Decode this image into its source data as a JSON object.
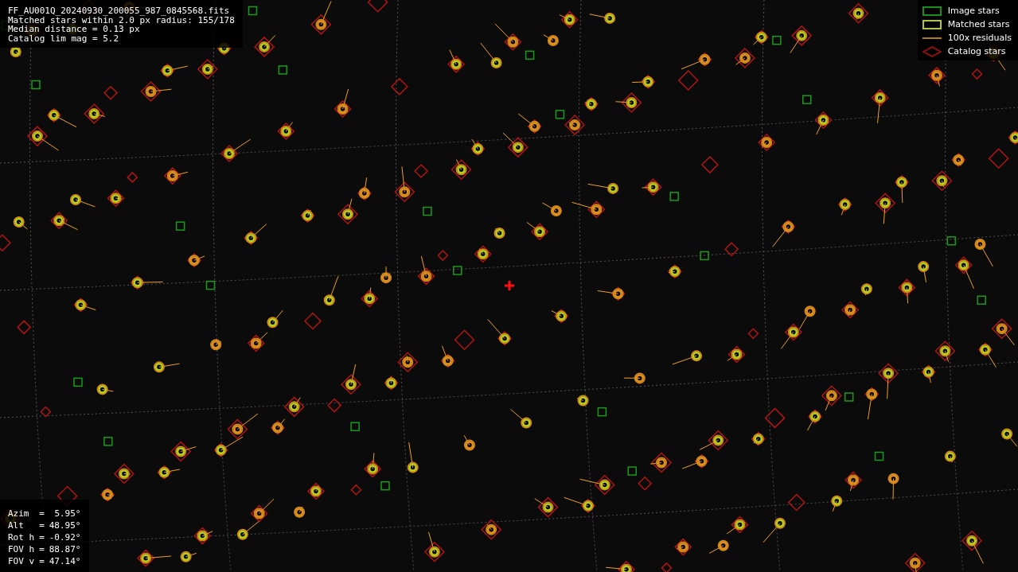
{
  "info": {
    "lines": [
      "FF_AU001Q_20240930_200055_987_0845568.fits",
      "Matched stars within 2.0 px radius: 155/178",
      "Median distance = 0.13 px",
      "Catalog lim mag = 5.2"
    ]
  },
  "legend": [
    {
      "kind": "image",
      "label": "Image stars"
    },
    {
      "kind": "matched",
      "label": "Matched stars"
    },
    {
      "kind": "residual",
      "label": "100x residuals"
    },
    {
      "kind": "catalog",
      "label": "Catalog stars"
    }
  ],
  "pointing": [
    {
      "label": "Azim",
      "sign": "=",
      "value": "5.95°"
    },
    {
      "label": "Alt",
      "sign": "=",
      "value": "48.95°"
    },
    {
      "label": "Rot h",
      "sign": "=",
      "value": "-0.92°"
    },
    {
      "label": "FOV h",
      "sign": "=",
      "value": "88.87°"
    },
    {
      "label": "FOV v",
      "sign": "=",
      "value": "47.14°"
    }
  ]
}
